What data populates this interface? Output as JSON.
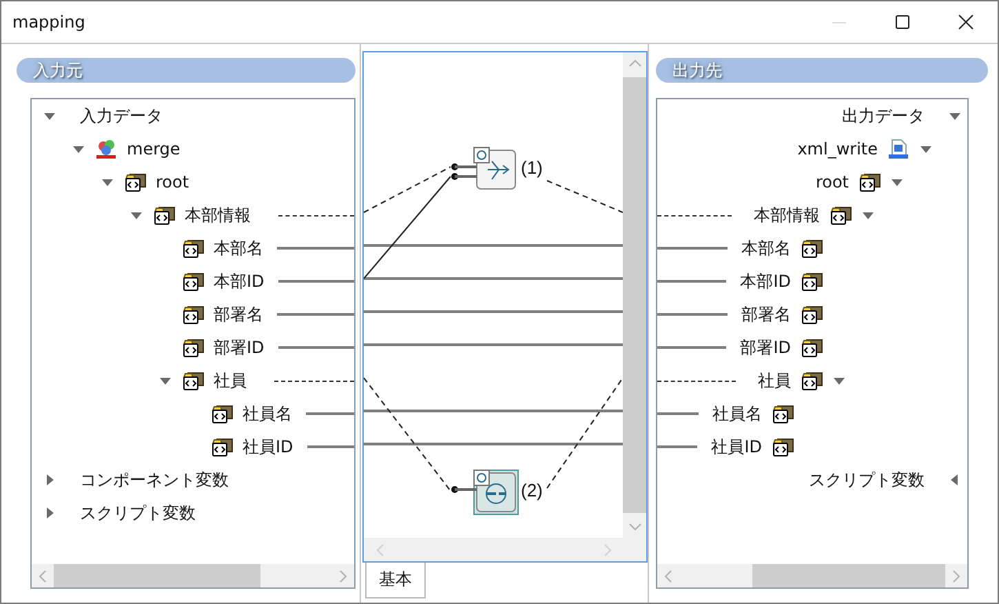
{
  "window": {
    "title": "mapping",
    "controls": [
      {
        "kind": "minimize",
        "disabled": true
      },
      {
        "kind": "maximize",
        "disabled": false
      },
      {
        "kind": "close",
        "disabled": false
      }
    ]
  },
  "source": {
    "title": "入力元",
    "tree": [
      {
        "label": "入力データ",
        "expanded": true,
        "linked": false,
        "children": [
          {
            "label": "merge",
            "kind": "merge",
            "expanded": true,
            "linked": false,
            "children": [
              {
                "label": "root",
                "kind": "element",
                "expanded": true,
                "linked": false,
                "children": [
                  {
                    "label": "本部情報",
                    "kind": "element",
                    "expanded": true,
                    "linked": true,
                    "dashed": true,
                    "children": [
                      {
                        "label": "本部名",
                        "kind": "element",
                        "linked": true,
                        "dashed": false
                      },
                      {
                        "label": "本部ID",
                        "kind": "element",
                        "linked": true,
                        "dashed": false
                      },
                      {
                        "label": "部署名",
                        "kind": "element",
                        "linked": true,
                        "dashed": false
                      },
                      {
                        "label": "部署ID",
                        "kind": "element",
                        "linked": true,
                        "dashed": false
                      },
                      {
                        "label": "社員",
                        "kind": "element",
                        "expanded": true,
                        "linked": true,
                        "dashed": true,
                        "children": [
                          {
                            "label": "社員名",
                            "kind": "element",
                            "linked": true,
                            "dashed": false
                          },
                          {
                            "label": "社員ID",
                            "kind": "element",
                            "linked": true,
                            "dashed": false
                          }
                        ]
                      }
                    ]
                  }
                ]
              }
            ]
          }
        ]
      },
      {
        "label": "コンポーネント変数",
        "expanded": false,
        "linked": false
      },
      {
        "label": "スクリプト変数",
        "expanded": false,
        "linked": false
      }
    ]
  },
  "canvas": {
    "nodes": [
      {
        "label": "(1)",
        "kind": "merge",
        "selected": false
      },
      {
        "label": "(2)",
        "kind": "loop",
        "selected": true
      }
    ]
  },
  "tabs": [
    {
      "label": "基本",
      "selected": true
    }
  ],
  "target": {
    "title": "出力先",
    "tree": [
      {
        "label": "出力データ",
        "expanded": true,
        "linked": false,
        "children": [
          {
            "label": "xml_write",
            "kind": "document",
            "expanded": true,
            "linked": false,
            "children": [
              {
                "label": "root",
                "kind": "element",
                "expanded": true,
                "linked": false,
                "children": [
                  {
                    "label": "本部情報",
                    "kind": "element",
                    "expanded": true,
                    "linked": true,
                    "dashed": true,
                    "children": [
                      {
                        "label": "本部名",
                        "kind": "element",
                        "linked": true,
                        "dashed": false
                      },
                      {
                        "label": "本部ID",
                        "kind": "element",
                        "linked": true,
                        "dashed": false
                      },
                      {
                        "label": "部署名",
                        "kind": "element",
                        "linked": true,
                        "dashed": false
                      },
                      {
                        "label": "部署ID",
                        "kind": "element",
                        "linked": true,
                        "dashed": false
                      },
                      {
                        "label": "社員",
                        "kind": "element",
                        "expanded": true,
                        "linked": true,
                        "dashed": true,
                        "children": [
                          {
                            "label": "社員名",
                            "kind": "element",
                            "linked": true,
                            "dashed": false
                          },
                          {
                            "label": "社員ID",
                            "kind": "element",
                            "linked": true,
                            "dashed": false
                          }
                        ]
                      }
                    ]
                  }
                ]
              }
            ]
          }
        ]
      },
      {
        "label": "スクリプト変数",
        "expanded": false,
        "linked": false
      }
    ]
  }
}
